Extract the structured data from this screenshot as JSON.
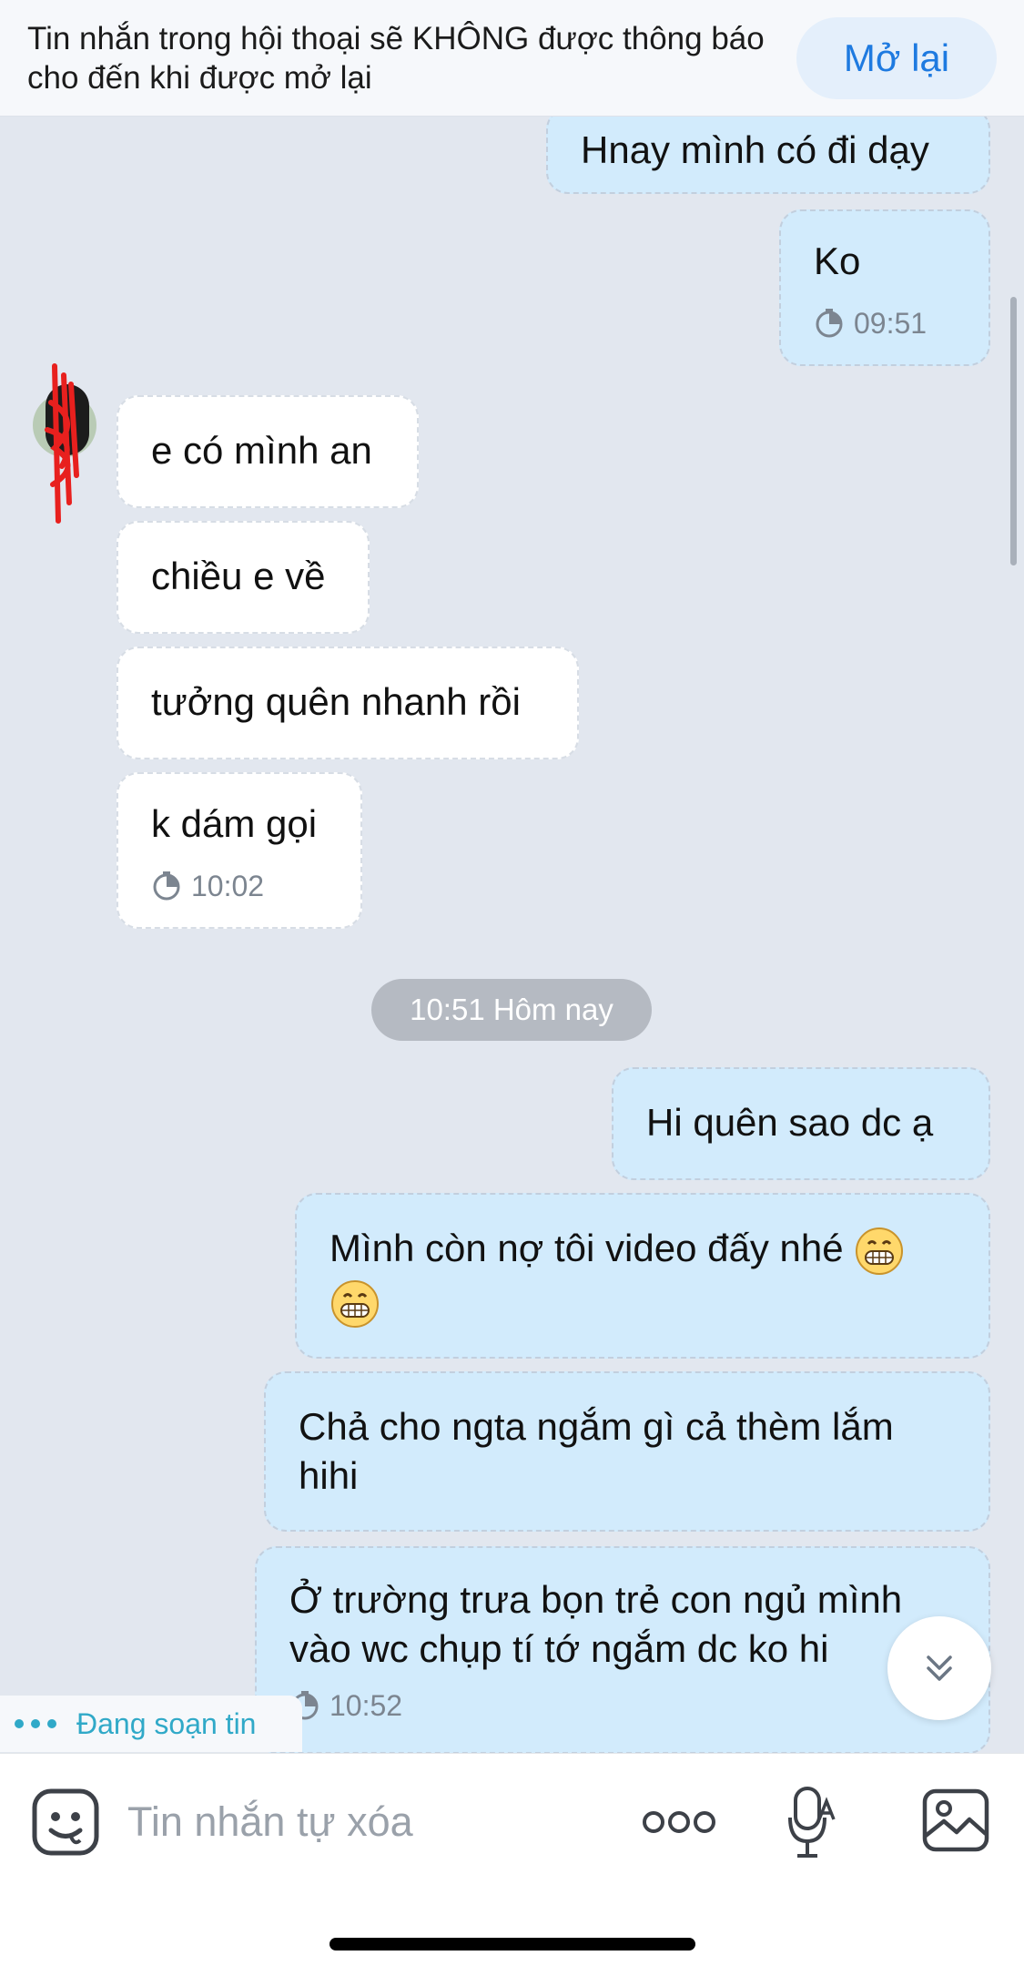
{
  "banner": {
    "text": "Tin nhắn trong hội thoại sẽ KHÔNG được thông báo cho đến khi được mở lại",
    "reopen_label": "Mở lại"
  },
  "messages": [
    {
      "side": "out",
      "text": "Hnay mình có đi dạy"
    },
    {
      "side": "out",
      "text": "Ko",
      "time": "09:51"
    },
    {
      "side": "in",
      "text": "e có mình an"
    },
    {
      "side": "in",
      "text": "chiều e về"
    },
    {
      "side": "in",
      "text": "tưởng quên nhanh rồi"
    },
    {
      "side": "in",
      "text": "k dám gọi",
      "time": "10:02"
    },
    {
      "side": "out",
      "text": "Hi quên sao dc ạ"
    },
    {
      "side": "out",
      "text": "Mình còn nợ tôi video đấy nhé",
      "emoji": "grinning-face"
    },
    {
      "side": "out",
      "text": "Chả cho ngta ngắm gì cả thèm lắm hihi"
    },
    {
      "side": "out",
      "text": "Ở trường trưa bọn trẻ con ngủ mình vào wc chụp tí tớ ngắm dc ko hi",
      "time": "10:52"
    }
  ],
  "date_separator": "10:51 Hôm nay",
  "typing_indicator": "Đang soạn tin",
  "composer": {
    "placeholder": "Tin nhắn tự xóa",
    "icons": [
      "emoji-icon",
      "more-icon",
      "mic-icon",
      "image-icon"
    ]
  },
  "colors": {
    "background": "#e2e7ef",
    "outgoing_bubble": "#d2ebfc",
    "incoming_bubble": "#ffffff",
    "accent": "#1e7ae0",
    "typing": "#30a9c8"
  }
}
